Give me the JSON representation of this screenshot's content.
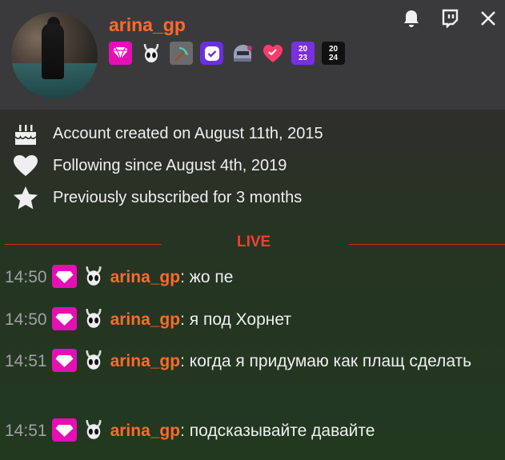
{
  "user": {
    "name": "arina_gp",
    "avatar": "avatar-image",
    "name_color": "#ff6a2b"
  },
  "badges": [
    {
      "icon": "gem-badge",
      "color": "#e50fb3"
    },
    {
      "icon": "hollow-knight-mask-badge"
    },
    {
      "icon": "pickaxe-badge"
    },
    {
      "icon": "verified-check-badge",
      "color": "#6b2fe0"
    },
    {
      "icon": "helmet-badge"
    },
    {
      "icon": "heart-bubble-badge",
      "color": "#ff3b6b"
    },
    {
      "icon": "year-2023-badge",
      "text_top": "20",
      "text_bottom": "23"
    },
    {
      "icon": "year-2024-badge",
      "text_top": "20",
      "text_bottom": "24"
    }
  ],
  "top_icons": [
    "bell-icon",
    "twitch-icon",
    "close-icon"
  ],
  "info": [
    {
      "icon": "cake-icon",
      "text": "Account created on August 11th, 2015"
    },
    {
      "icon": "heart-icon",
      "text": "Following since August 4th, 2019"
    },
    {
      "icon": "star-icon",
      "text": "Previously subscribed for 3 months"
    }
  ],
  "live_label": "LIVE",
  "messages": [
    {
      "time": "14:50",
      "user": "arina_gp",
      "text": "жо пе"
    },
    {
      "time": "14:50",
      "user": "arina_gp",
      "text": "я под Хорнет"
    },
    {
      "time": "14:51",
      "user": "arina_gp",
      "text": "когда я придумаю как плащ сделать"
    },
    {
      "time": "14:51",
      "user": "arina_gp",
      "text": "подсказывайте давайте"
    }
  ]
}
